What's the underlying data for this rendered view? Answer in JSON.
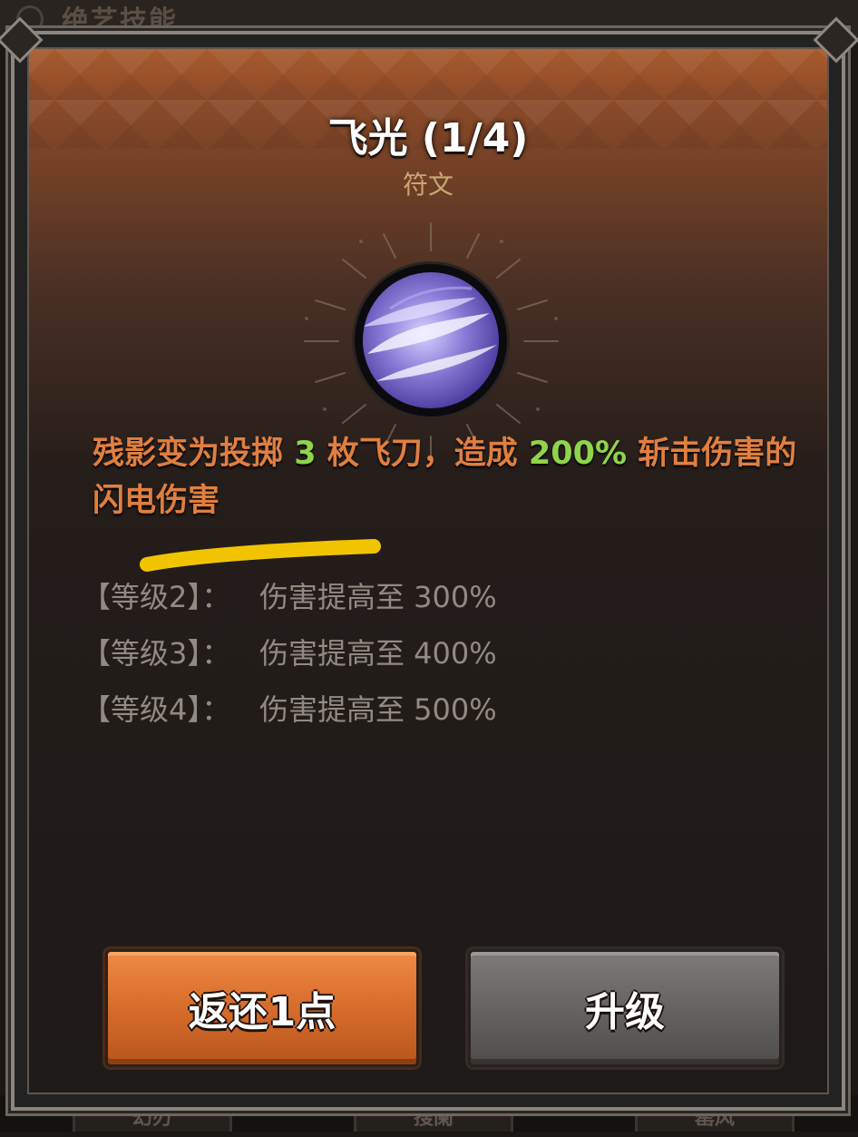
{
  "background": {
    "header_title": "绝艺技能",
    "tabs": [
      "幻刃",
      "搜阑",
      "罂风"
    ]
  },
  "skill": {
    "title": "飞光 (1/4)",
    "type": "符文",
    "icon": "lightning-blade-orb-icon"
  },
  "description": {
    "part1": "残影变为投掷 ",
    "num1": "3",
    "part2": " 枚飞刀，造成 ",
    "num2": "200%",
    "part3": " 斩击伤害的闪电伤害",
    "highlight_color": "#f2c400"
  },
  "levels": [
    {
      "label": "【等级2】：",
      "text": "伤害提高至 300%"
    },
    {
      "label": "【等级3】：",
      "text": "伤害提高至 400%"
    },
    {
      "label": "【等级4】：",
      "text": "伤害提高至 500%"
    }
  ],
  "buttons": {
    "refund": "返还1点",
    "upgrade": "升级"
  },
  "colors": {
    "description": "#e07f40",
    "number": "#8fd44b",
    "level_text": "#928a83",
    "refund_button": "#d96f2d",
    "upgrade_button": "#666462"
  }
}
